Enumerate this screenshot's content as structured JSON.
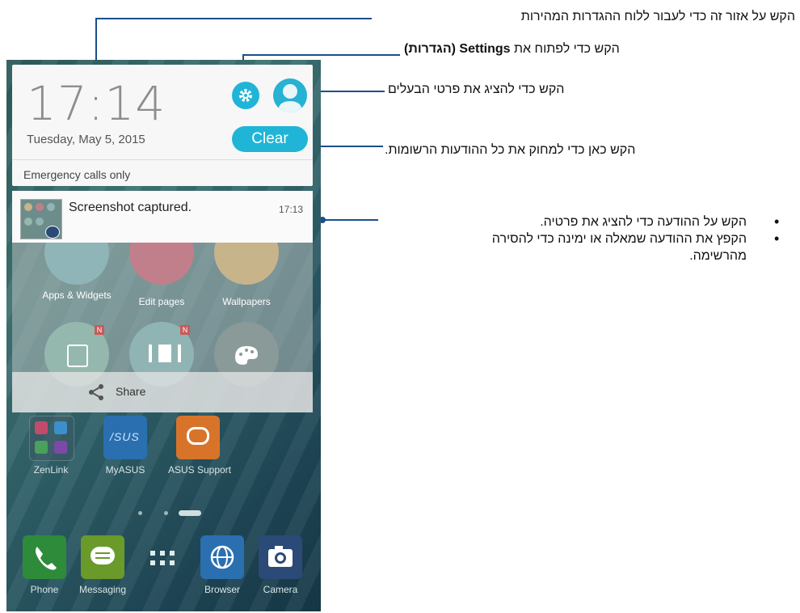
{
  "callouts": {
    "quick_settings": "הקש על אזור זה כדי לעבור ללוח ההגדרות המהירות",
    "settings_prefix": "הקש כדי לפתוח את ",
    "settings_bold": "Settings (הגדרות)",
    "owner": "הקש כדי להציג את פרטי הבעלים",
    "clear": "הקש כאן כדי למחוק את כל ההודעות הרשומות.",
    "notif_line1": "הקש על ההודעה כדי להציג את פרטיה.",
    "notif_line2a": "הקפץ את ההודעה שמאלה או ימינה כדי להסירה",
    "notif_line2b": "מהרשימה."
  },
  "quick_panel": {
    "time": "17:14",
    "date": "Tuesday, May 5, 2015",
    "clear_label": "Clear",
    "status": "Emergency calls only"
  },
  "notification": {
    "title": "Screenshot captured.",
    "time": "17:13"
  },
  "share_sheet": {
    "items": [
      "Apps & Widgets",
      "Edit pages",
      "Wallpapers"
    ],
    "share_label": "Share"
  },
  "home_apps": [
    "ZenLink",
    "MyASUS",
    "ASUS Support"
  ],
  "dock": [
    "Phone",
    "Messaging",
    "Browser",
    "Camera"
  ],
  "colors": {
    "accent": "#20b5d6",
    "callout_line": "#1a4f8c"
  }
}
